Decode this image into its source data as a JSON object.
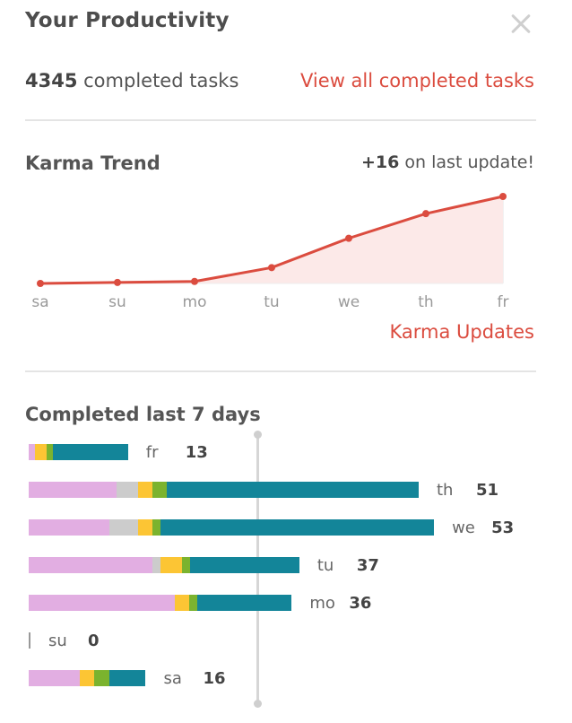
{
  "header": {
    "title": "Your Productivity"
  },
  "summary": {
    "completed_count": "4345",
    "completed_label": "completed tasks",
    "view_all_link": "View all completed tasks"
  },
  "karma": {
    "title": "Karma Trend",
    "change_value": "+16",
    "change_label": "on last update!",
    "updates_link": "Karma Updates"
  },
  "colors": {
    "accent": "#db4c3f",
    "segment_pink": "#e2aee2",
    "segment_gray": "#cccccc",
    "segment_yellow": "#fcc534",
    "segment_green": "#7bb32e",
    "segment_teal": "#138599"
  },
  "chart_data": [
    {
      "type": "area",
      "categories": [
        "sa",
        "su",
        "mo",
        "tu",
        "we",
        "th",
        "fr"
      ],
      "values": [
        0,
        0.3,
        0.6,
        4.7,
        13.4,
        20.7,
        25.8
      ]
    },
    {
      "type": "bar",
      "orientation": "horizontal",
      "rows": [
        {
          "day": "fr",
          "total": 13,
          "segments": [
            0.8,
            1.6,
            0.8,
            9.8
          ]
        },
        {
          "day": "th",
          "total": 51,
          "segments": [
            11.5,
            2.8,
            1.9,
            1.9,
            32.9
          ]
        },
        {
          "day": "we",
          "total": 53,
          "segments": [
            10.5,
            3.8,
            1.9,
            1.0,
            35.8
          ]
        },
        {
          "day": "tu",
          "total": 37,
          "segments": [
            16.2,
            1.0,
            2.9,
            1.0,
            14.3
          ]
        },
        {
          "day": "mo",
          "total": 36,
          "segments": [
            19.1,
            1.9,
            1.0,
            12.4
          ]
        },
        {
          "day": "su",
          "total": 0,
          "segments": []
        },
        {
          "day": "sa",
          "total": 16,
          "segments": [
            6.7,
            1.9,
            1.9,
            4.8
          ]
        }
      ],
      "segment_colors": [
        [
          "segment_pink",
          "segment_yellow",
          "segment_green",
          "segment_teal"
        ],
        [
          "segment_pink",
          "segment_gray",
          "segment_yellow",
          "segment_green",
          "segment_teal"
        ],
        [
          "segment_pink",
          "segment_gray",
          "segment_yellow",
          "segment_green",
          "segment_teal"
        ],
        [
          "segment_pink",
          "segment_gray",
          "segment_yellow",
          "segment_green",
          "segment_teal"
        ],
        [
          "segment_pink",
          "segment_yellow",
          "segment_green",
          "segment_teal"
        ],
        [],
        [
          "segment_pink",
          "segment_yellow",
          "segment_green",
          "segment_teal"
        ]
      ]
    }
  ],
  "completed_section": {
    "title": "Completed last 7 days"
  }
}
